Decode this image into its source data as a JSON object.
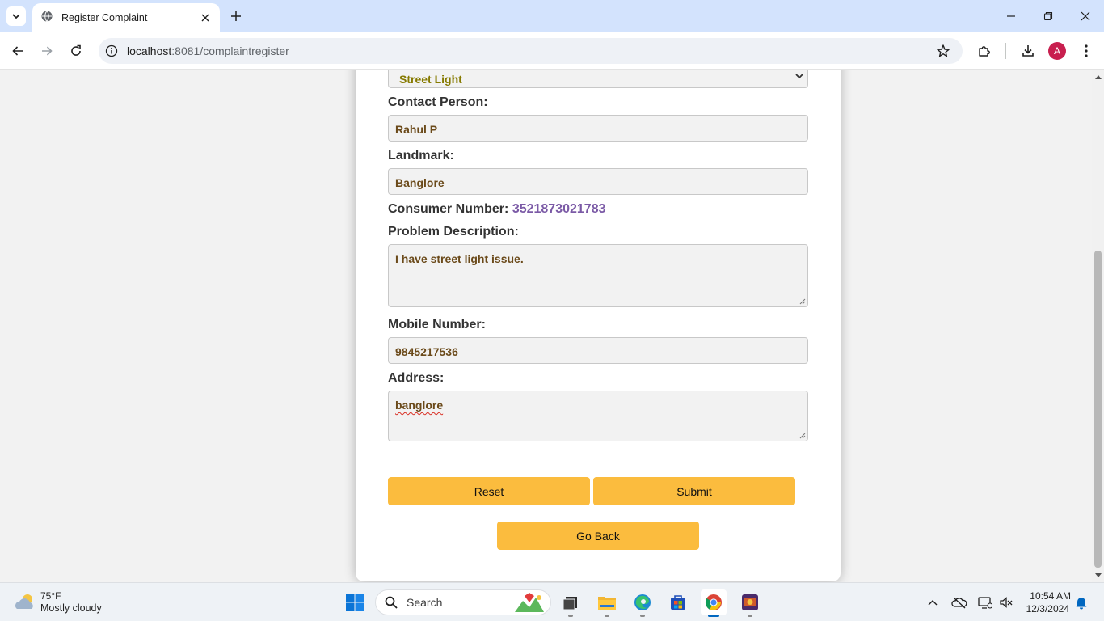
{
  "browser": {
    "tab_title": "Register Complaint",
    "url_host": "localhost",
    "url_rest": ":8081/complaintregister",
    "profile_initial": "A"
  },
  "form": {
    "category_selected": "Street Light",
    "contact_person_label": "Contact Person:",
    "contact_person_value": "Rahul P",
    "landmark_label": "Landmark:",
    "landmark_value": "Banglore",
    "consumer_number_label": "Consumer Number:",
    "consumer_number_value": "3521873021783",
    "problem_label": "Problem Description:",
    "problem_value": "I have street light issue.",
    "mobile_label": "Mobile Number:",
    "mobile_value": "9845217536",
    "address_label": "Address:",
    "address_value": "banglore",
    "reset_label": "Reset",
    "submit_label": "Submit",
    "go_back_label": "Go Back"
  },
  "taskbar": {
    "weather_temp": "75°F",
    "weather_desc": "Mostly cloudy",
    "search_label": "Search",
    "time": "10:54 AM",
    "date": "12/3/2024"
  },
  "colors": {
    "accent_button": "#fbbc3e",
    "select_text": "#867a00",
    "field_text": "#6b4a1a",
    "consumer_number": "#7b5aa6",
    "chrome_tabbar": "#d3e3fd"
  },
  "icons": [
    "tab-list-icon",
    "globe-icon",
    "close-icon",
    "plus-icon",
    "minimize-icon",
    "restore-icon",
    "back-icon",
    "forward-icon",
    "reload-icon",
    "site-info-icon",
    "star-icon",
    "extensions-icon",
    "download-icon",
    "more-icon",
    "chevron-down-icon",
    "weather-cloud-icon",
    "windows-start-icon",
    "search-icon",
    "task-view-icon",
    "file-explorer-icon",
    "edge-icon",
    "store-icon",
    "chrome-icon",
    "app-icon",
    "chevron-up-icon",
    "onedrive-icon",
    "network-icon",
    "volume-icon",
    "notification-bell-icon"
  ]
}
